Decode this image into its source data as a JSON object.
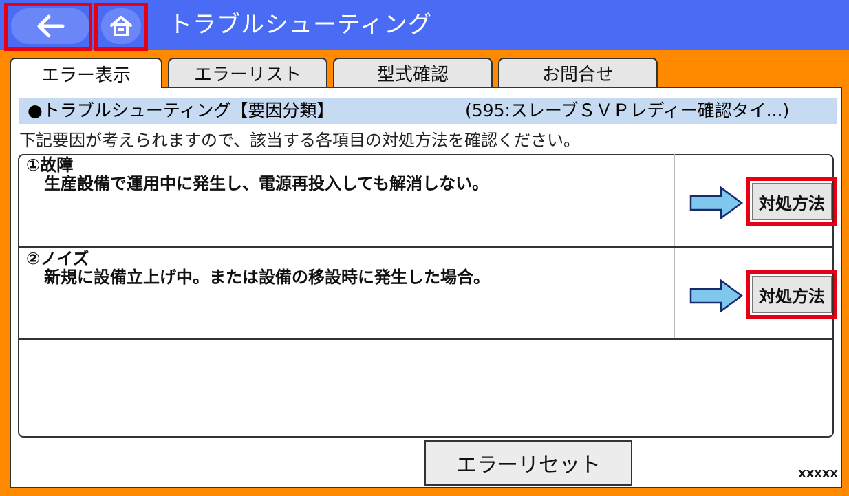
{
  "header": {
    "back_icon": "arrow-left-icon",
    "home_icon": "home-icon",
    "title": "トラブルシューティング"
  },
  "tabs": [
    {
      "label": "エラー表示",
      "active": true
    },
    {
      "label": "エラーリスト",
      "active": false
    },
    {
      "label": "型式確認",
      "active": false
    },
    {
      "label": "お問合せ",
      "active": false
    }
  ],
  "section": {
    "title": "●トラブルシューティング【要因分類】",
    "error": "(595:スレーブＳＶＰレディー確認タイ...)"
  },
  "intro": "下記要因が考えられますので、該当する各項目の対処方法を確認ください。",
  "causes": [
    {
      "name": "①故障",
      "desc": "生産設備で運用中に発生し、電源再投入しても解消しない。",
      "action": "対処方法"
    },
    {
      "name": "②ノイズ",
      "desc": "新規に設備立上げ中。または設備の移設時に発生した場合。",
      "action": "対処方法"
    }
  ],
  "reset_label": "エラーリセット",
  "code": "XXXXX",
  "colors": {
    "header": "#4a6cf4",
    "frame": "#ff8a00",
    "highlight": "#e60012",
    "section_bar": "#c6daf2"
  }
}
